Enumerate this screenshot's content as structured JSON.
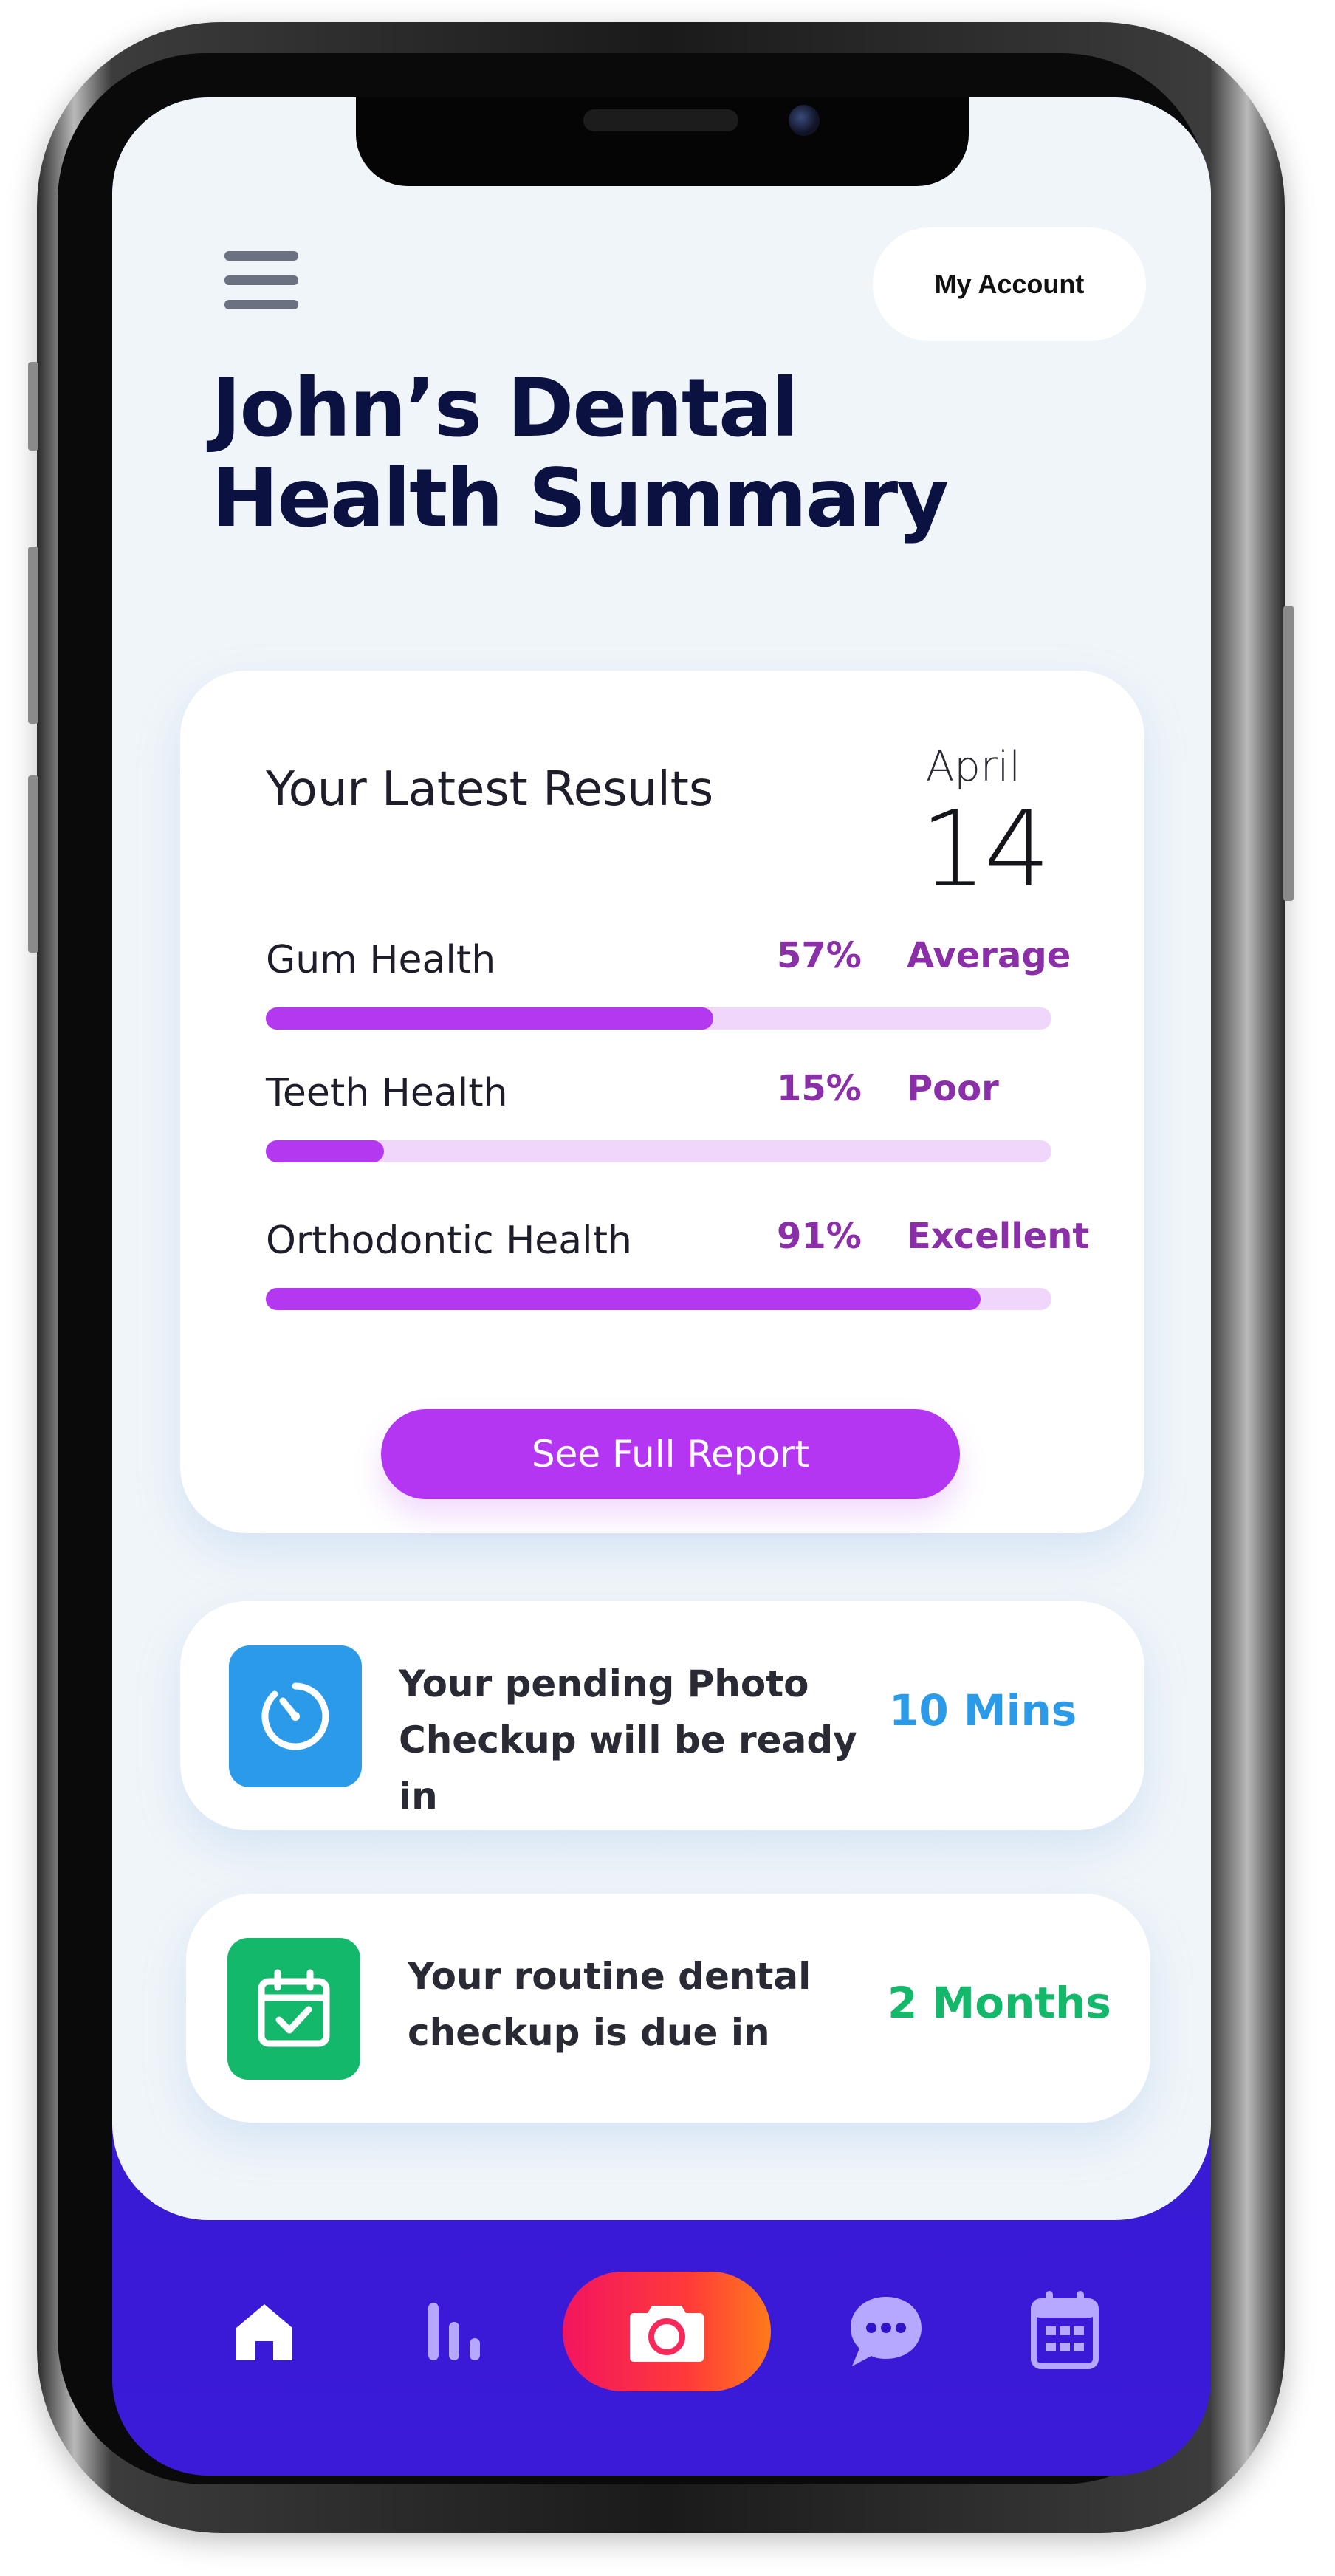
{
  "header": {
    "account_label": "My Account",
    "title_line1": "John’s Dental",
    "title_line2": "Health Summary"
  },
  "results": {
    "title": "Your Latest Results",
    "date_month": "April",
    "date_day": "14",
    "metrics": [
      {
        "label": "Gum Health",
        "percent_text": "57%",
        "rating": "Average",
        "progress_fraction": 0.57
      },
      {
        "label": "Teeth Health",
        "percent_text": "15%",
        "rating": "Poor",
        "progress_fraction": 0.15
      },
      {
        "label": "Orthodontic Health",
        "percent_text": "91%",
        "rating": "Excellent",
        "progress_fraction": 0.91
      }
    ],
    "report_button": "See Full Report"
  },
  "photo_checkup": {
    "line1": "Your pending Photo",
    "line2": "Checkup will be ready in",
    "value": "10 Mins",
    "icon": "timer-icon",
    "accent_color": "#2b9be9"
  },
  "dental_checkup": {
    "line1": "Your routine dental",
    "line2": "checkup is due in",
    "value": "2 Months",
    "icon": "calendar-check-icon",
    "accent_color": "#13b86b"
  },
  "nav": {
    "items": [
      "home-icon",
      "stats-icon",
      "camera-icon",
      "chat-icon",
      "calendar-icon"
    ],
    "active": "home-icon"
  },
  "colors": {
    "title": "#0b1140",
    "progress_fill": "#b538f1",
    "progress_track": "#f0d6fb",
    "rating_text": "#8a2fa8",
    "nav_background": "#2f14cc",
    "camera_gradient_start": "#f2155f",
    "camera_gradient_end": "#ff7a1a"
  }
}
